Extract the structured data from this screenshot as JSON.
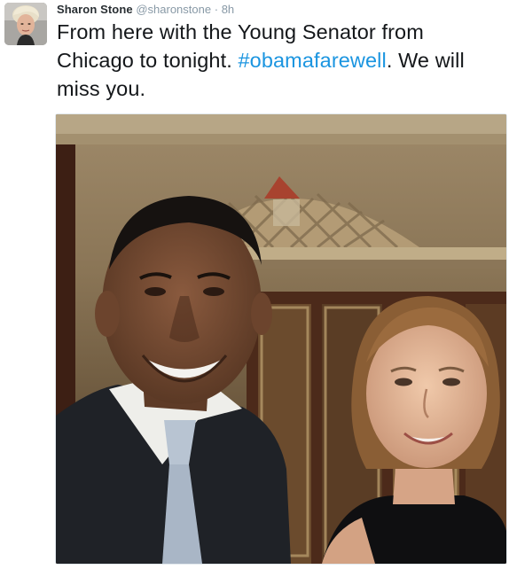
{
  "tweet": {
    "author_name": "Sharon Stone",
    "author_handle": "@sharonstone",
    "separator": "·",
    "time": "8h",
    "text_before": "From here with the Young Senator from Chicago to tonight. ",
    "hashtag": "#obamafarewell",
    "text_after": ". We will miss you."
  },
  "colors": {
    "text": "#14171a",
    "secondary": "#8899a6",
    "hashtag": "#1b95e0"
  },
  "icons": [
    "avatar-photo",
    "tweet-photo"
  ]
}
